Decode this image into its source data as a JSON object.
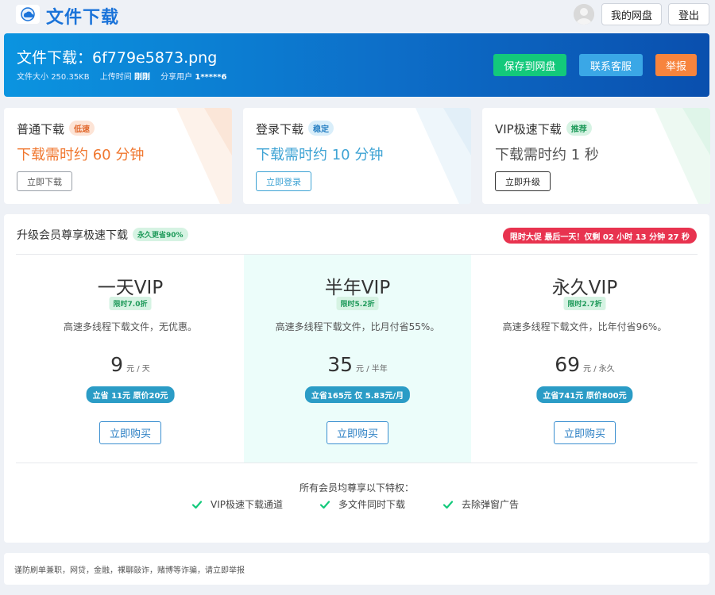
{
  "header": {
    "site_title": "文件下载",
    "logo_icon": "cloud-logo-icon",
    "avatar_icon": "user-avatar-icon",
    "my_disk_label": "我的网盘",
    "logout_label": "登出"
  },
  "hero": {
    "title": "文件下载：6f779e5873.png",
    "size_label": "文件大小",
    "size_value": "250.35KB",
    "upload_label": "上传时间",
    "upload_value": "刚刚",
    "share_label": "分享用户",
    "share_value": "1*****6",
    "save_label": "保存到网盘",
    "service_label": "联系客服",
    "report_label": "举报"
  },
  "modes": [
    {
      "name": "普通下载",
      "tag": "低速",
      "time": "下载需时约 60 分钟",
      "button": "立即下载"
    },
    {
      "name": "登录下载",
      "tag": "稳定",
      "time": "下载需时约 10 分钟",
      "button": "立即登录"
    },
    {
      "name": "VIP极速下载",
      "tag": "推荐",
      "time": "下载需时约 1 秒",
      "button": "立即升级"
    }
  ],
  "vip": {
    "heading": "升级会员尊享极速下载",
    "heading_tag": "永久更省90%",
    "promo": "限时大促 最后一天！仅剩 02 小时 13 分钟 27 秒",
    "plans": [
      {
        "name": "一天VIP",
        "discount": "限时7.0折",
        "desc": "高速多线程下载文件，无优惠。",
        "price": "9",
        "unit": "元 / 天",
        "save": "立省 11元 原价20元",
        "buy": "立即购买"
      },
      {
        "name": "半年VIP",
        "discount": "限时5.2折",
        "desc": "高速多线程下载文件，比月付省55%。",
        "price": "35",
        "unit": "元 / 半年",
        "save": "立省165元 仅 5.83元/月",
        "buy": "立即购买"
      },
      {
        "name": "永久VIP",
        "discount": "限时2.7折",
        "desc": "高速多线程下载文件，比年付省96%。",
        "price": "69",
        "unit": "元 / 永久",
        "save": "立省741元 原价800元",
        "buy": "立即购买"
      }
    ],
    "benefits_title": "所有会员均尊享以下特权：",
    "benefits": [
      "VIP极速下载通道",
      "多文件同时下载",
      "去除弹窗广告"
    ]
  },
  "notice": {
    "text": "谨防刷单兼职，网贷，金融，裸聊敲诈，赌博等诈骗，请立即举报"
  },
  "colors": {
    "brand": "#1a73d9",
    "hero_start": "#0b94e0",
    "hero_end": "#0a4fae",
    "save_green": "#13c97b",
    "service_blue": "#3aa7e6",
    "report_orange": "#f7843d",
    "promo_red": "#e8334f",
    "active_plan_bg": "#ecfdfa"
  }
}
